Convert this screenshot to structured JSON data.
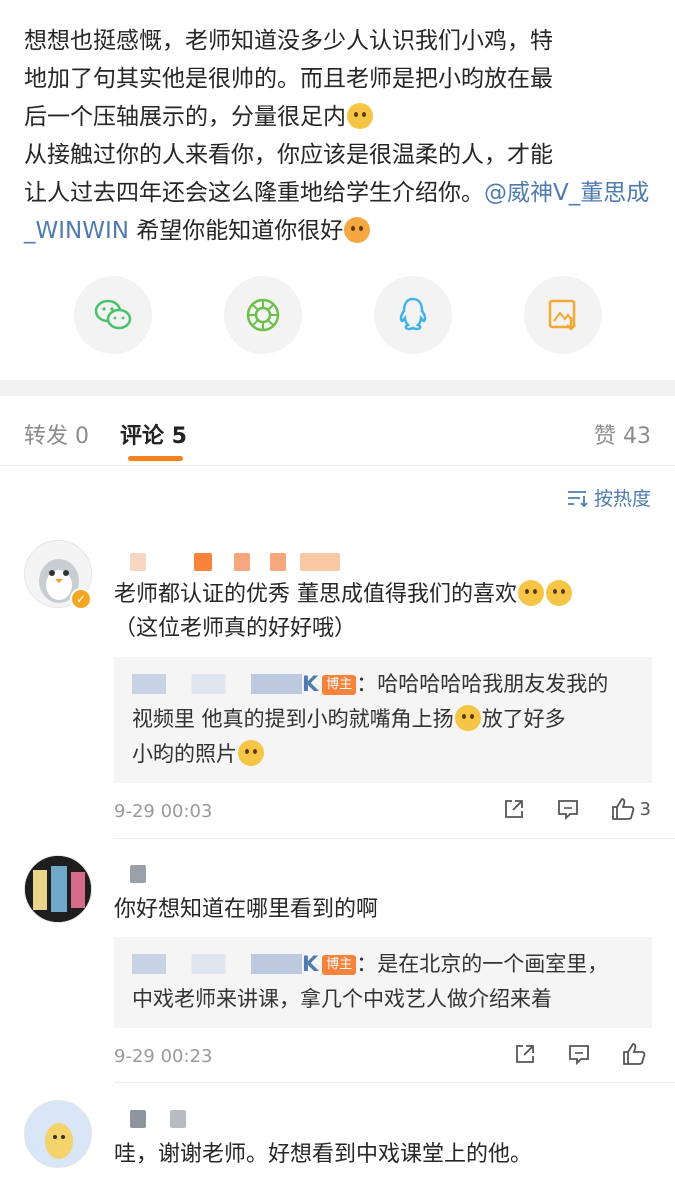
{
  "post": {
    "line1": "想想也挺感慨，老师知道没多少人认识我们小鸡，特",
    "line2": "地加了句其实他是很帅的。而且老师是把小昀放在最",
    "line3": "后一个压轴展示的，分量很足内",
    "line4": "从接触过你的人来看你，你应该是很温柔的人，才能",
    "line5": "让人过去四年还会这么隆重地给学生介绍你。",
    "mention": "@威神V_董思成_WINWIN",
    "line6_tail": "希望你能知道你很好"
  },
  "share": {
    "icons": [
      "wechat-icon",
      "moments-icon",
      "qq-icon",
      "save-image-icon"
    ]
  },
  "tabs": {
    "repost": "转发 0",
    "comments": "评论 5",
    "likes": "赞 43"
  },
  "sort": {
    "label": "按热度"
  },
  "comments": [
    {
      "text": "老师都认证的优秀 董思成值得我们的喜欢",
      "text2": "（这位老师真的好好哦）",
      "reply_suffix": "K",
      "reply_badge": "博主",
      "reply_text": "：哈哈哈哈哈我朋友发我的",
      "reply_text2": "视频里 他真的提到小昀就嘴角上扬",
      "reply_text2b": "放了好多",
      "reply_text3": "小昀的照片",
      "time": "9-29 00:03",
      "like_count": "3"
    },
    {
      "text": "你好想知道在哪里看到的啊",
      "reply_suffix": "K",
      "reply_badge": "博主",
      "reply_text": "：是在北京的一个画室里，",
      "reply_text2": "中戏老师来讲课，拿几个中戏艺人做介绍来着",
      "time": "9-29 00:23",
      "like_count": ""
    },
    {
      "text": "哇，谢谢老师。好想看到中戏课堂上的他。"
    }
  ],
  "colors": {
    "accent": "#f4801f",
    "link": "#4f7cb0",
    "badge": "#f6833c"
  }
}
